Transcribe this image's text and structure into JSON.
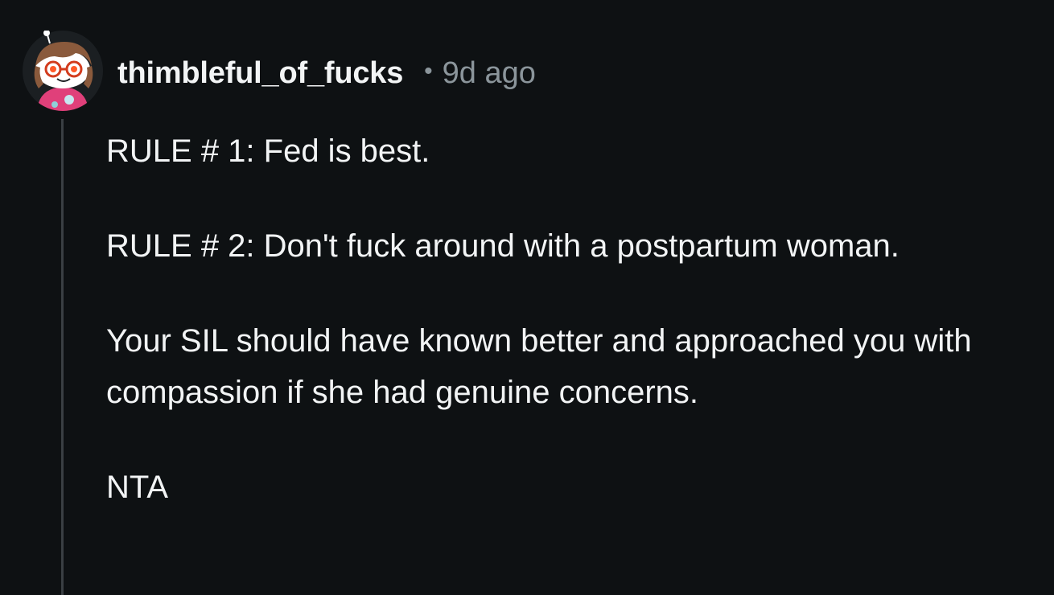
{
  "comment": {
    "username": "thimbleful_of_fucks",
    "separator": "•",
    "timestamp": "9d ago",
    "avatar": "snoo-avatar-with-glasses",
    "paragraphs": [
      "RULE # 1: Fed is best.",
      "RULE # 2: Don't fuck around with a postpartum woman.",
      "Your SIL should have known better and approached you with compassion if she had genuine concerns.",
      "NTA"
    ]
  },
  "colors": {
    "background": "#0e1113",
    "text": "#f2f4f5",
    "muted": "#8b959b",
    "thread_line": "#3a3f43"
  }
}
